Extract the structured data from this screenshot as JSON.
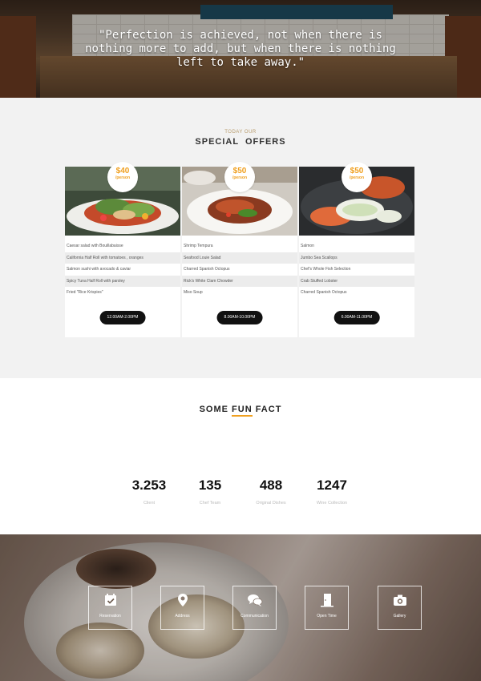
{
  "hero": {
    "quote": "\"Perfection is achieved, not when there is nothing more to add, but when there is nothing left to take away.\""
  },
  "offers": {
    "eyebrow": "TODAY OUR",
    "heading": "SPECIAL  OFFERS",
    "cards": [
      {
        "price": "$40",
        "unit": "/person",
        "items": [
          "Caesar salad with Bouillabaisse",
          "California Half Roll with tomatoes , oranges",
          "Salmon sushi with avocado & caviar",
          "Spicy Tuna Half Roll with parsley",
          "Fried \"Rice Krispies\""
        ],
        "hours": "12.00AM-2.00PM"
      },
      {
        "price": "$50",
        "unit": "/person",
        "items": [
          "Shrimp Tempura",
          "Seafood Louie Salad",
          "Charred Spanish Octopus",
          "Rick's White Clam Chowder",
          "Miso Soup"
        ],
        "hours": "8.00AM-10.00PM"
      },
      {
        "price": "$50",
        "unit": "/person",
        "items": [
          "Salmon",
          "Jumbo Sea Scallops",
          "Chef's Whole Fish Selection",
          "Crab Stuffed Lobster",
          "Charred Spanish Octopus"
        ],
        "hours": "6.00AM-11.00PM"
      }
    ]
  },
  "facts": {
    "title_pre": "SOME ",
    "title_hl": "FUN",
    "title_post": " FACT",
    "items": [
      {
        "value": "3.253",
        "label": "Client"
      },
      {
        "value": "135",
        "label": "Chef Team"
      },
      {
        "value": "488",
        "label": "Original Dishes"
      },
      {
        "value": "1247",
        "label": "Wine Collection"
      }
    ]
  },
  "services": [
    {
      "label": "Reservation",
      "icon": "calendar-check-icon"
    },
    {
      "label": "Address",
      "icon": "map-pin-icon"
    },
    {
      "label": "Communication",
      "icon": "chat-bubbles-icon"
    },
    {
      "label": "Open Time",
      "icon": "door-icon"
    },
    {
      "label": "Gallery",
      "icon": "camera-icon"
    }
  ],
  "colors": {
    "accent": "#f0a020",
    "section_bg": "#f2f2f2",
    "button_bg": "#111111"
  }
}
